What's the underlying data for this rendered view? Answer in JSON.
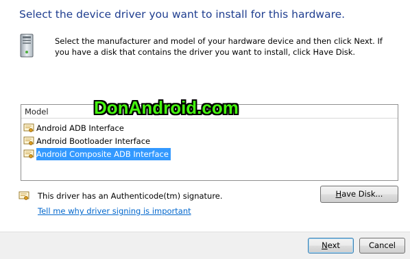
{
  "heading": "Select the device driver you want to install for this hardware.",
  "description": "Select the manufacturer and model of your hardware device and then click Next. If you have a disk that contains the driver you want to install, click Have Disk.",
  "list": {
    "header": "Model",
    "items": [
      {
        "label": "Android ADB Interface",
        "selected": false
      },
      {
        "label": "Android Bootloader Interface",
        "selected": false
      },
      {
        "label": "Android Composite ADB Interface",
        "selected": true
      }
    ]
  },
  "watermark": "DonAndroid.com",
  "signature_text": "This driver has an Authenticode(tm) signature.",
  "link_text": "Tell me why driver signing is important",
  "buttons": {
    "have_disk": {
      "mnemonic": "H",
      "rest": "ave Disk..."
    },
    "next": {
      "mnemonic": "N",
      "rest": "ext"
    },
    "cancel": "Cancel"
  },
  "colors": {
    "heading": "#1e3d8f",
    "link": "#0066cc",
    "selection": "#3399ff",
    "watermark": "#45f50e"
  },
  "icons": {
    "hardware": "computer-tower-icon",
    "driver": "certificate-icon",
    "signature": "certificate-icon"
  }
}
